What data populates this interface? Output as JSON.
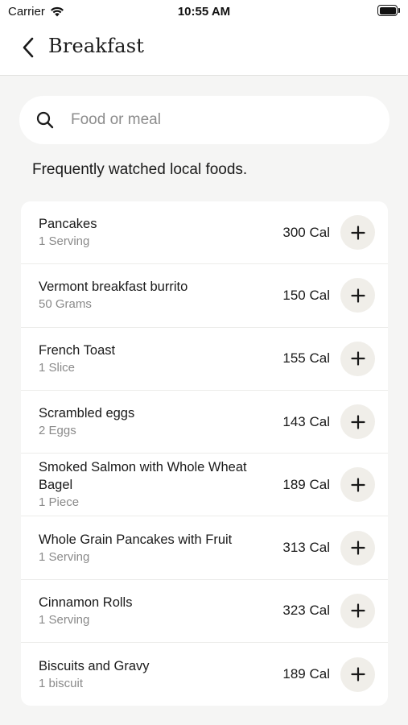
{
  "status_bar": {
    "carrier": "Carrier",
    "time": "10:55 AM"
  },
  "nav": {
    "title": "Breakfast",
    "back_icon": "chevron-left-icon"
  },
  "search": {
    "placeholder": "Food or meal",
    "value": "",
    "icon": "search-icon"
  },
  "section_title": "Frequently watched local foods.",
  "foods": [
    {
      "name": "Pancakes",
      "portion": "1 Serving",
      "calories": "300 Cal"
    },
    {
      "name": "Vermont breakfast burrito",
      "portion": "50 Grams",
      "calories": "150 Cal"
    },
    {
      "name": "French Toast",
      "portion": "1 Slice",
      "calories": "155 Cal"
    },
    {
      "name": "Scrambled eggs",
      "portion": "2 Eggs",
      "calories": "143 Cal"
    },
    {
      "name": "Smoked Salmon with Whole Wheat Bagel",
      "portion": "1 Piece",
      "calories": "189 Cal"
    },
    {
      "name": "Whole Grain Pancakes with Fruit",
      "portion": "1 Serving",
      "calories": "313 Cal"
    },
    {
      "name": "Cinnamon Rolls",
      "portion": "1 Serving",
      "calories": "323 Cal"
    },
    {
      "name": "Biscuits and Gravy",
      "portion": "1 biscuit",
      "calories": "189 Cal"
    }
  ],
  "colors": {
    "background": "#f5f5f4",
    "card": "#ffffff",
    "add_button": "#f0eee9",
    "secondary_text": "#8a8a8a"
  }
}
